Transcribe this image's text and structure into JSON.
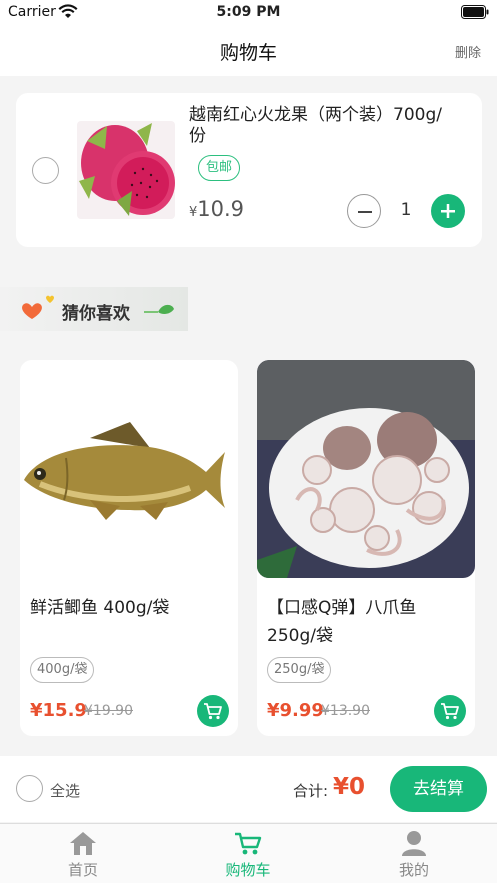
{
  "status_bar": {
    "carrier": "Carrier",
    "time": "5:09 PM"
  },
  "nav": {
    "title": "购物车",
    "delete_label": "删除"
  },
  "cart_item": {
    "name": "越南红心火龙果（两个装）700g/份",
    "tag": "包邮",
    "currency": "¥",
    "price": "10.9",
    "quantity": "1"
  },
  "guess": {
    "title": "猜你喜欢"
  },
  "products": [
    {
      "name": "鲜活鲫鱼 400g/袋",
      "tag": "400g/袋",
      "price": "¥15.9",
      "old_price": "¥19.90"
    },
    {
      "name": "【口感Q弹】八爪鱼 250g/袋",
      "tag": "250g/袋",
      "price": "¥9.99",
      "old_price": "¥13.90"
    }
  ],
  "checkout": {
    "select_all_label": "全选",
    "total_label": "合计:",
    "total_value": "¥0",
    "button_label": "去结算"
  },
  "tabs": [
    {
      "label": "首页",
      "icon": "home-icon"
    },
    {
      "label": "购物车",
      "icon": "cart-icon"
    },
    {
      "label": "我的",
      "icon": "user-icon"
    }
  ],
  "colors": {
    "accent": "#18b779",
    "price": "#e8502f",
    "background": "#f4f4f4"
  }
}
